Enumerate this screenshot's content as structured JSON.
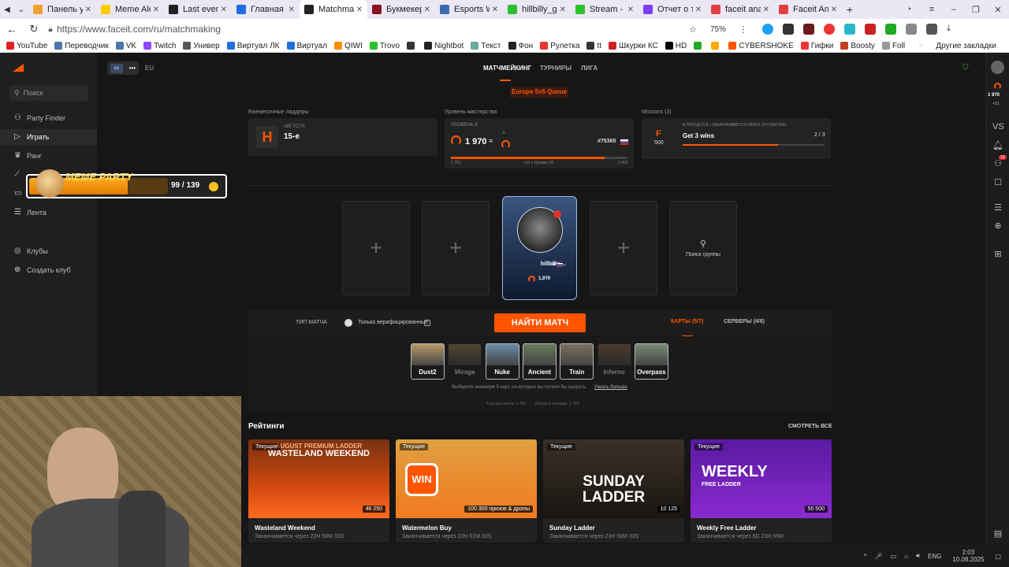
{
  "browser": {
    "tabs": [
      {
        "label": "Панель упра",
        "color": "#f0a030"
      },
      {
        "label": "Meme Alerts",
        "color": "#ffcc00"
      },
      {
        "label": "Last events - ",
        "color": "#222222"
      },
      {
        "label": "Главная",
        "color": "#1e6fe0"
      },
      {
        "label": "Matchmaki",
        "color": "#222222"
      },
      {
        "label": "Букмекерска",
        "color": "#8b1020"
      },
      {
        "label": "Esports World",
        "color": "#3a6bb0"
      },
      {
        "label": "hillbilly_gg Str",
        "color": "#2cc12c"
      },
      {
        "label": "Stream - Kick",
        "color": "#2cc12c"
      },
      {
        "label": "Отчет о тран",
        "color": "#7b3ff2"
      },
      {
        "label": "faceit analyzer",
        "color": "#e04040"
      },
      {
        "label": "Faceit Anal",
        "color": "#e04040"
      }
    ],
    "url": "https://www.faceit.com/ru/matchmaking",
    "zoom": "75%",
    "bookmarks": [
      "YouTube",
      "Переводчик",
      "VK",
      "Twitch",
      "Универ",
      "Виртуал ЛК",
      "Виртуал",
      "QIWI",
      "Trovo",
      "",
      "Nightbot",
      "Текст",
      "Фон",
      "Рулетка",
      "tt",
      "Шкурки КС",
      "HD",
      "",
      "",
      "CYBERSHOKE",
      "Гифки",
      "Boosty",
      "Foll"
    ],
    "other_bookmarks": "Другие закладки"
  },
  "sidebar": {
    "search": "Поиск",
    "items": [
      "Party Finder",
      "Играть",
      "Ранг",
      "",
      "",
      "Лента"
    ],
    "clubs": "Клубы",
    "create_club": "Создать клуб"
  },
  "header": {
    "region": "EU",
    "tabs": [
      "МАТЧМЕЙКИНГ",
      "ТУРНИРЫ",
      "ЛИГА"
    ],
    "queue": "Europe 5v5 Queue"
  },
  "cards": {
    "ladders_title": "Ежемесячные ладдеры",
    "ladder_month": "АВГУСТА",
    "ladder_rank": "15-е",
    "mastery_title": "Уровень мастерства",
    "mastery_level": "УРОВЕНЬ 9",
    "elo": "1 970",
    "rank_pos": "#75365",
    "elo_min": "1 751",
    "elo_mid": "+31 к Уровню 10",
    "elo_max": "2 000",
    "elo_progress": 0.87,
    "missions_title": "Missions (3)",
    "mission_status": "В ПРОЦЕССЕ • ЗАКАНЧИВАЕТСЯ ЧЕРЕЗ 22Ч 00М 56М",
    "mission_name": "Get 3 wins",
    "mission_count": "2 / 3",
    "mission_points": "500",
    "mission_progress": 0.67
  },
  "party": {
    "player_name": "hillbilly-...",
    "player_elo": "1,970",
    "find_group": "Поиск группы"
  },
  "match": {
    "type_label": "ТИП МАТЧА",
    "verified_only": "Только верифицированные",
    "find_button": "НАЙТИ МАТЧ",
    "maps_tab": "КАРТЫ (5/7)",
    "servers_tab": "СЕРВЕРЫ (4/8)",
    "maps": [
      {
        "name": "Dust2",
        "on": true
      },
      {
        "name": "Mirage",
        "on": false
      },
      {
        "name": "Nuke",
        "on": true
      },
      {
        "name": "Ancient",
        "on": true
      },
      {
        "name": "Train",
        "on": true
      },
      {
        "name": "Inferno",
        "on": false
      },
      {
        "name": "Overpass",
        "on": true
      }
    ],
    "hint": "Выберите минимум 5 карт, на которых вы хотели бы сыграть.",
    "hint_link": "Узнать больше",
    "stats": "Текущие матчи: 5 431        Игроки в очереди: 1 763"
  },
  "ratings": {
    "title": "Рейтинги",
    "see_all": "СМОТРЕТЬ ВСЕ",
    "items": [
      {
        "badge": "Текущие",
        "headline": "WASTELAND WEEKEND",
        "sub": "AUGUST PREMIUM LADDER",
        "prize": "46 250",
        "name": "Wasteland Weekend",
        "ends": "Заканчивается через 23Н 56М 33S"
      },
      {
        "badge": "Текущие",
        "headline": "WIN",
        "sub": "",
        "prize": "100 300 призов & дропы",
        "name": "Watermelon Buy",
        "ends": "Заканчивается через 23Н 51М 33S"
      },
      {
        "badge": "Текущие",
        "headline": "SUNDAY LADDER",
        "sub": "",
        "prize": "10 125",
        "name": "Sunday Ladder",
        "ends": "Заканчивается через 23Н 56М 33S"
      },
      {
        "badge": "Текущие",
        "headline": "WEEKLY",
        "sub": "FREE LADDER",
        "prize": "50 500",
        "name": "Weekly Free Ladder",
        "ends": "Заканчивается через 6D 23Н 56М"
      }
    ]
  },
  "overlay": {
    "meme_party": "MEME PARTY",
    "counter": "99 / 139"
  },
  "rightbar": {
    "elo": "1 970",
    "delta": "+31",
    "notif": "19"
  },
  "taskbar": {
    "lang": "ENG",
    "time": "2:03",
    "date": "10.08.2025"
  }
}
